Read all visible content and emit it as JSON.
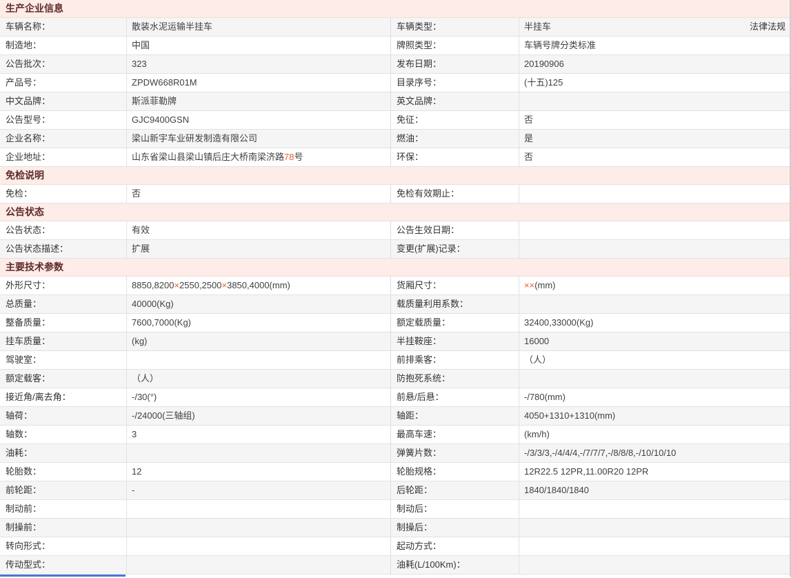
{
  "highlight_color": "#e8602c",
  "legal_link_label": "法律法规",
  "sections": [
    {
      "title": "生产企业信息",
      "rows": [
        {
          "label_left": "车辆名称：",
          "value_left": "散装水泥运输半挂车",
          "label_right": "车辆类型：",
          "value_right": "半挂车"
        },
        {
          "label_left": "制造地：",
          "value_left": "中国",
          "label_right": "牌照类型：",
          "value_right": "车辆号牌分类标准"
        },
        {
          "label_left": "公告批次：",
          "value_left": "323",
          "label_right": "发布日期：",
          "value_right": "20190906"
        },
        {
          "label_left": "产品号：",
          "value_left": "ZPDW668R01M",
          "label_right": "目录序号：",
          "value_right": "(十五)125"
        },
        {
          "label_left": "中文品牌：",
          "value_left": "斯派菲勒牌",
          "label_right": "英文品牌：",
          "value_right": ""
        },
        {
          "label_left": "公告型号：",
          "value_left": "GJC9400GSN",
          "label_right": "免征：",
          "value_right": "否"
        },
        {
          "label_left": "企业名称：",
          "value_left": "梁山新宇车业研发制造有限公司",
          "label_right": "燃油：",
          "value_right": "是"
        },
        {
          "label_left": "企业地址：",
          "value_left": "山东省梁山县梁山镇后庄大桥南梁济路78号",
          "label_right": "环保：",
          "value_right": "否"
        }
      ]
    },
    {
      "title": "免检说明",
      "rows": [
        {
          "label_left": "免检：",
          "value_left": "否",
          "label_right": "免检有效期止：",
          "value_right": ""
        }
      ]
    },
    {
      "title": "公告状态",
      "rows": [
        {
          "label_left": "公告状态：",
          "value_left": "有效",
          "label_right": "公告生效日期：",
          "value_right": ""
        },
        {
          "label_left": "公告状态描述：",
          "value_left": "扩展",
          "label_right": "变更(扩展)记录：",
          "value_right": ""
        }
      ]
    },
    {
      "title": "主要技术参数",
      "rows": [
        {
          "label_left": "外形尺寸：",
          "value_left": "8850,8200×2550,2500×3850,4000(mm)",
          "label_right": "货厢尺寸：",
          "value_right": "××(mm)"
        },
        {
          "label_left": "总质量：",
          "value_left": "40000(Kg)",
          "label_right": "载质量利用系数：",
          "value_right": ""
        },
        {
          "label_left": "整备质量：",
          "value_left": "7600,7000(Kg)",
          "label_right": "额定载质量：",
          "value_right": "32400,33000(Kg)"
        },
        {
          "label_left": "挂车质量：",
          "value_left": "(kg)",
          "label_right": "半挂鞍座：",
          "value_right": "16000"
        },
        {
          "label_left": "驾驶室：",
          "value_left": "",
          "label_right": "前排乘客：",
          "value_right": "（人）"
        },
        {
          "label_left": "额定载客：",
          "value_left": "（人）",
          "label_right": "防抱死系统：",
          "value_right": ""
        },
        {
          "label_left": "接近角/离去角：",
          "value_left": "-/30(°)",
          "label_right": "前悬/后悬：",
          "value_right": "-/780(mm)"
        },
        {
          "label_left": "轴荷：",
          "value_left": "-/24000(三轴组)",
          "label_right": "轴距：",
          "value_right": "4050+1310+1310(mm)"
        },
        {
          "label_left": "轴数：",
          "value_left": "3",
          "label_right": "最高车速：",
          "value_right": "(km/h)"
        },
        {
          "label_left": "油耗：",
          "value_left": "",
          "label_right": "弹簧片数：",
          "value_right": "-/3/3/3,-/4/4/4,-/7/7/7,-/8/8/8,-/10/10/10"
        },
        {
          "label_left": "轮胎数：",
          "value_left": "12",
          "label_right": "轮胎规格：",
          "value_right": "12R22.5 12PR,11.00R20 12PR"
        },
        {
          "label_left": "前轮距：",
          "value_left": "-",
          "label_right": "后轮距：",
          "value_right": "1840/1840/1840"
        },
        {
          "label_left": "制动前：",
          "value_left": "",
          "label_right": "制动后：",
          "value_right": ""
        },
        {
          "label_left": "制操前：",
          "value_left": "",
          "label_right": "制操后：",
          "value_right": ""
        },
        {
          "label_left": "转向形式：",
          "value_left": "",
          "label_right": "起动方式：",
          "value_right": ""
        },
        {
          "label_left": "传动型式：",
          "value_left": "",
          "label_right": "油耗(L/100Km)：",
          "value_right": ""
        }
      ]
    }
  ]
}
